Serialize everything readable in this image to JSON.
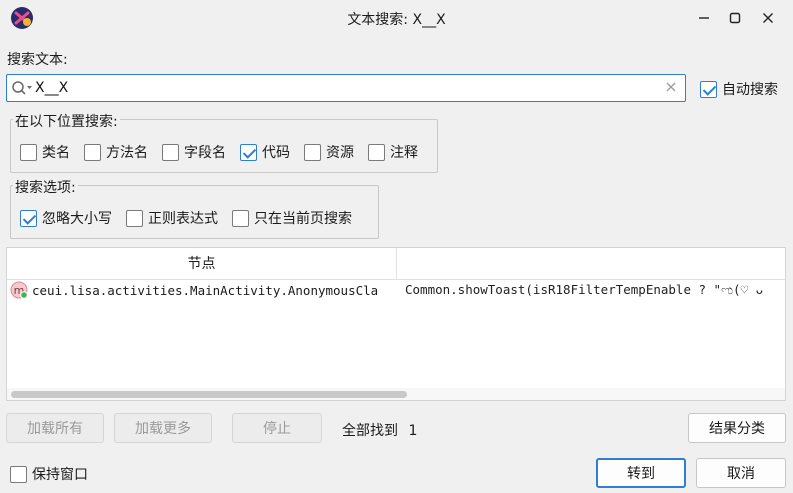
{
  "window": {
    "title": "文本搜索: X__X"
  },
  "search": {
    "label": "搜索文本:",
    "value": "X__X",
    "auto_search_label": "自动搜索",
    "auto_search_checked": true
  },
  "locations": {
    "title": "在以下位置搜索:",
    "items": [
      {
        "label": "类名",
        "checked": false
      },
      {
        "label": "方法名",
        "checked": false
      },
      {
        "label": "字段名",
        "checked": false
      },
      {
        "label": "代码",
        "checked": true
      },
      {
        "label": "资源",
        "checked": false
      },
      {
        "label": "注释",
        "checked": false
      }
    ]
  },
  "options": {
    "title": "搜索选项:",
    "items": [
      {
        "label": "忽略大小写",
        "checked": true
      },
      {
        "label": "正则表达式",
        "checked": false
      },
      {
        "label": "只在当前页搜索",
        "checked": false
      }
    ]
  },
  "results": {
    "columns": [
      "节点",
      ""
    ],
    "rows": [
      {
        "icon": "method-icon",
        "node": "ceui.lisa.activities.MainActivity.AnonymousCla",
        "code": "Common.showToast(isR18FilterTempEnable ? \"ಌ(♡ ᴗ"
      }
    ]
  },
  "bottom": {
    "load_all": "加载所有",
    "load_more": "加载更多",
    "stop": "停止",
    "found_label": "全部找到",
    "found_count": "1",
    "categorize": "结果分类",
    "keep_window": "保持窗口",
    "goto": "转到",
    "cancel": "取消"
  },
  "colors": {
    "accent": "#2f7fd1",
    "background": "#f0f0f0"
  }
}
